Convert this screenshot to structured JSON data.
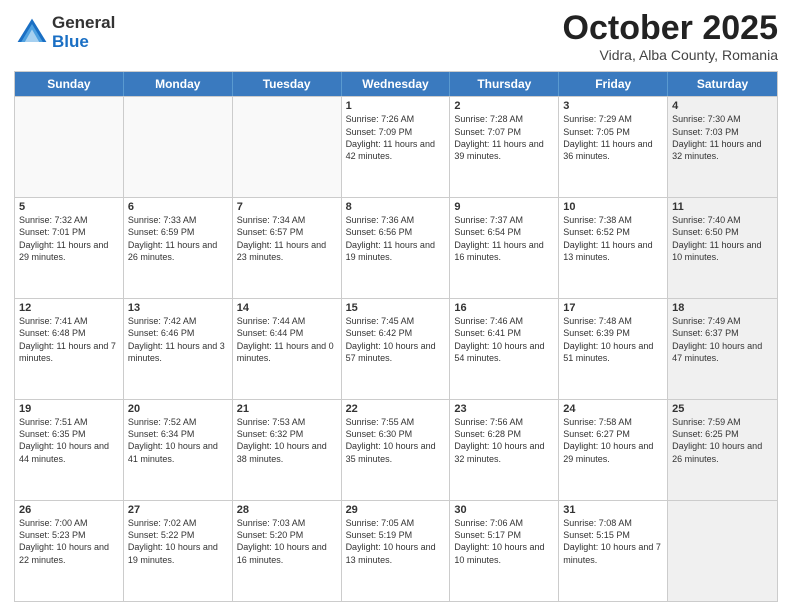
{
  "header": {
    "logo_general": "General",
    "logo_blue": "Blue",
    "month_title": "October 2025",
    "location": "Vidra, Alba County, Romania"
  },
  "weekdays": [
    "Sunday",
    "Monday",
    "Tuesday",
    "Wednesday",
    "Thursday",
    "Friday",
    "Saturday"
  ],
  "rows": [
    [
      {
        "day": "",
        "info": "",
        "empty": true
      },
      {
        "day": "",
        "info": "",
        "empty": true
      },
      {
        "day": "",
        "info": "",
        "empty": true
      },
      {
        "day": "1",
        "info": "Sunrise: 7:26 AM\nSunset: 7:09 PM\nDaylight: 11 hours\nand 42 minutes."
      },
      {
        "day": "2",
        "info": "Sunrise: 7:28 AM\nSunset: 7:07 PM\nDaylight: 11 hours\nand 39 minutes."
      },
      {
        "day": "3",
        "info": "Sunrise: 7:29 AM\nSunset: 7:05 PM\nDaylight: 11 hours\nand 36 minutes."
      },
      {
        "day": "4",
        "info": "Sunrise: 7:30 AM\nSunset: 7:03 PM\nDaylight: 11 hours\nand 32 minutes.",
        "shaded": true
      }
    ],
    [
      {
        "day": "5",
        "info": "Sunrise: 7:32 AM\nSunset: 7:01 PM\nDaylight: 11 hours\nand 29 minutes."
      },
      {
        "day": "6",
        "info": "Sunrise: 7:33 AM\nSunset: 6:59 PM\nDaylight: 11 hours\nand 26 minutes."
      },
      {
        "day": "7",
        "info": "Sunrise: 7:34 AM\nSunset: 6:57 PM\nDaylight: 11 hours\nand 23 minutes."
      },
      {
        "day": "8",
        "info": "Sunrise: 7:36 AM\nSunset: 6:56 PM\nDaylight: 11 hours\nand 19 minutes."
      },
      {
        "day": "9",
        "info": "Sunrise: 7:37 AM\nSunset: 6:54 PM\nDaylight: 11 hours\nand 16 minutes."
      },
      {
        "day": "10",
        "info": "Sunrise: 7:38 AM\nSunset: 6:52 PM\nDaylight: 11 hours\nand 13 minutes."
      },
      {
        "day": "11",
        "info": "Sunrise: 7:40 AM\nSunset: 6:50 PM\nDaylight: 11 hours\nand 10 minutes.",
        "shaded": true
      }
    ],
    [
      {
        "day": "12",
        "info": "Sunrise: 7:41 AM\nSunset: 6:48 PM\nDaylight: 11 hours\nand 7 minutes."
      },
      {
        "day": "13",
        "info": "Sunrise: 7:42 AM\nSunset: 6:46 PM\nDaylight: 11 hours\nand 3 minutes."
      },
      {
        "day": "14",
        "info": "Sunrise: 7:44 AM\nSunset: 6:44 PM\nDaylight: 11 hours\nand 0 minutes."
      },
      {
        "day": "15",
        "info": "Sunrise: 7:45 AM\nSunset: 6:42 PM\nDaylight: 10 hours\nand 57 minutes."
      },
      {
        "day": "16",
        "info": "Sunrise: 7:46 AM\nSunset: 6:41 PM\nDaylight: 10 hours\nand 54 minutes."
      },
      {
        "day": "17",
        "info": "Sunrise: 7:48 AM\nSunset: 6:39 PM\nDaylight: 10 hours\nand 51 minutes."
      },
      {
        "day": "18",
        "info": "Sunrise: 7:49 AM\nSunset: 6:37 PM\nDaylight: 10 hours\nand 47 minutes.",
        "shaded": true
      }
    ],
    [
      {
        "day": "19",
        "info": "Sunrise: 7:51 AM\nSunset: 6:35 PM\nDaylight: 10 hours\nand 44 minutes."
      },
      {
        "day": "20",
        "info": "Sunrise: 7:52 AM\nSunset: 6:34 PM\nDaylight: 10 hours\nand 41 minutes."
      },
      {
        "day": "21",
        "info": "Sunrise: 7:53 AM\nSunset: 6:32 PM\nDaylight: 10 hours\nand 38 minutes."
      },
      {
        "day": "22",
        "info": "Sunrise: 7:55 AM\nSunset: 6:30 PM\nDaylight: 10 hours\nand 35 minutes."
      },
      {
        "day": "23",
        "info": "Sunrise: 7:56 AM\nSunset: 6:28 PM\nDaylight: 10 hours\nand 32 minutes."
      },
      {
        "day": "24",
        "info": "Sunrise: 7:58 AM\nSunset: 6:27 PM\nDaylight: 10 hours\nand 29 minutes."
      },
      {
        "day": "25",
        "info": "Sunrise: 7:59 AM\nSunset: 6:25 PM\nDaylight: 10 hours\nand 26 minutes.",
        "shaded": true
      }
    ],
    [
      {
        "day": "26",
        "info": "Sunrise: 7:00 AM\nSunset: 5:23 PM\nDaylight: 10 hours\nand 22 minutes."
      },
      {
        "day": "27",
        "info": "Sunrise: 7:02 AM\nSunset: 5:22 PM\nDaylight: 10 hours\nand 19 minutes."
      },
      {
        "day": "28",
        "info": "Sunrise: 7:03 AM\nSunset: 5:20 PM\nDaylight: 10 hours\nand 16 minutes."
      },
      {
        "day": "29",
        "info": "Sunrise: 7:05 AM\nSunset: 5:19 PM\nDaylight: 10 hours\nand 13 minutes."
      },
      {
        "day": "30",
        "info": "Sunrise: 7:06 AM\nSunset: 5:17 PM\nDaylight: 10 hours\nand 10 minutes."
      },
      {
        "day": "31",
        "info": "Sunrise: 7:08 AM\nSunset: 5:15 PM\nDaylight: 10 hours\nand 7 minutes."
      },
      {
        "day": "",
        "info": "",
        "empty": true,
        "shaded": true
      }
    ]
  ]
}
